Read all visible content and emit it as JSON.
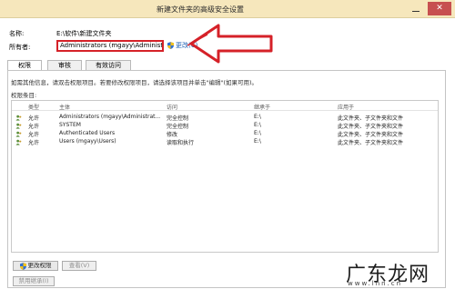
{
  "window": {
    "title": "新建文件夹的高级安全设置",
    "close_glyph": "✕"
  },
  "fields": {
    "name_label": "名称:",
    "name_value": "E:\\软件\\新建文件夹",
    "owner_label": "所有者:",
    "owner_value": "Administrators (mgayy\\Administrators)",
    "change_link": "更改(C)"
  },
  "tabs": [
    {
      "label": "权限"
    },
    {
      "label": "审核"
    },
    {
      "label": "有效访问"
    }
  ],
  "panel": {
    "info_text": "如需其他信息，请双击权限项目。若要修改权限项目，请选择该项目并单击\"编辑\"(如果可用)。",
    "entries_title": "权限条目:"
  },
  "table": {
    "columns": [
      "类型",
      "主体",
      "访问",
      "继承于",
      "应用于"
    ],
    "rows": [
      {
        "type": "允许",
        "principal": "Administrators (mgayy\\Administrat...",
        "access": "完全控制",
        "inherited": "E:\\",
        "applies": "此文件夹、子文件夹和文件"
      },
      {
        "type": "允许",
        "principal": "SYSTEM",
        "access": "完全控制",
        "inherited": "E:\\",
        "applies": "此文件夹、子文件夹和文件"
      },
      {
        "type": "允许",
        "principal": "Authenticated Users",
        "access": "修改",
        "inherited": "E:\\",
        "applies": "此文件夹、子文件夹和文件"
      },
      {
        "type": "允许",
        "principal": "Users (mgayy\\Users)",
        "access": "读取和执行",
        "inherited": "E:\\",
        "applies": "此文件夹、子文件夹和文件"
      }
    ]
  },
  "buttons": {
    "change_permissions": "更改权限",
    "view": "查看(V)",
    "disable_inheritance": "禁用继承(I)"
  },
  "watermark": {
    "text": "广东龙网",
    "url": "www.lnn.cn"
  },
  "colors": {
    "titlebar": "#f6e7bc",
    "annotation_red": "#d52128",
    "link_blue": "#1a5fb4"
  },
  "icons": [
    "close-icon",
    "shield-icon",
    "red-arrow-annotation",
    "user-group-icon"
  ]
}
